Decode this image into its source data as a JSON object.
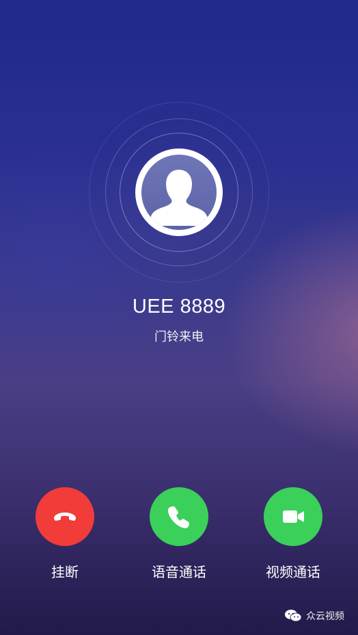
{
  "caller": {
    "name": "UEE 8889",
    "status": "门铃来电"
  },
  "actions": {
    "hangup_label": "挂断",
    "voice_label": "语音通话",
    "video_label": "视频通话"
  },
  "icons": {
    "avatar": "person-silhouette-icon",
    "hangup": "phone-hangup-icon",
    "voice": "phone-icon",
    "video": "video-camera-icon",
    "watermark": "wechat-icon"
  },
  "colors": {
    "hangup": "#f23c3a",
    "accept": "#3bd05a",
    "avatar_bg": "#6f76b8"
  },
  "watermark": {
    "text": "众云视频"
  }
}
